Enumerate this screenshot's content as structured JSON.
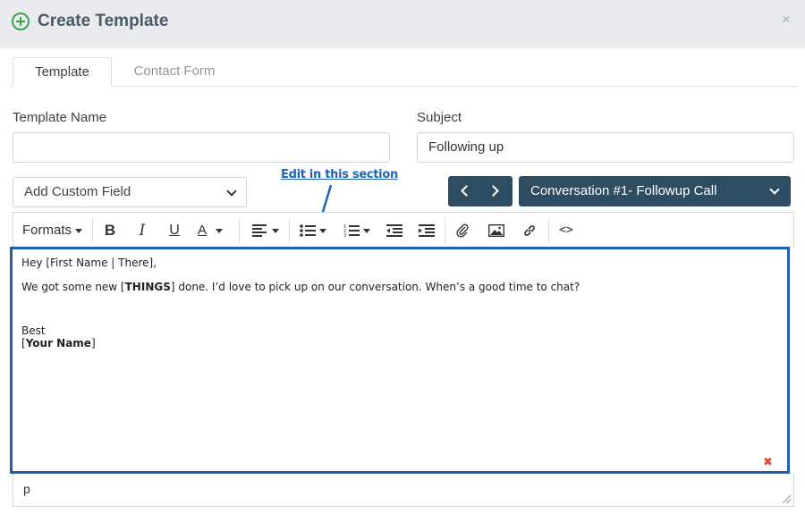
{
  "header": {
    "title": "Create Template",
    "add_icon": "plus-circle-icon",
    "close_icon": "close-icon",
    "close_glyph": "×"
  },
  "tabs": [
    {
      "label": "Template",
      "active": true
    },
    {
      "label": "Contact Form",
      "active": false
    }
  ],
  "form": {
    "template_name_label": "Template Name",
    "template_name_value": "",
    "subject_label": "Subject",
    "subject_value": "Following up",
    "custom_field_select": "Add Custom Field",
    "conversation_select": "Conversation #1- Followup Call"
  },
  "annotation": {
    "text": "Edit in this section",
    "color": "#1f64b8"
  },
  "toolbar": {
    "formats_label": "Formats",
    "buttons": [
      "bold",
      "italic",
      "underline",
      "text-color",
      "align",
      "bullet-list",
      "numbered-list",
      "outdent",
      "indent",
      "attachment",
      "image",
      "link",
      "source-code"
    ]
  },
  "editor": {
    "line1": "Hey [First Name | There],",
    "line2_pre": "We got some new [",
    "line2_bold": "THINGS",
    "line2_post": "] done. I’d love to pick up on our conversation. When’s a good time to chat?",
    "line3": "Best",
    "line4_pre": "[",
    "line4_bold": "Your Name",
    "line4_post": "]",
    "clear_icon": "red-x-icon",
    "clear_glyph": "✖"
  },
  "statusbar": {
    "path": "p"
  },
  "colors": {
    "primary_dark": "#2e4d63",
    "accent_green": "#3aa54a",
    "highlight_border": "#1f5fb0"
  }
}
